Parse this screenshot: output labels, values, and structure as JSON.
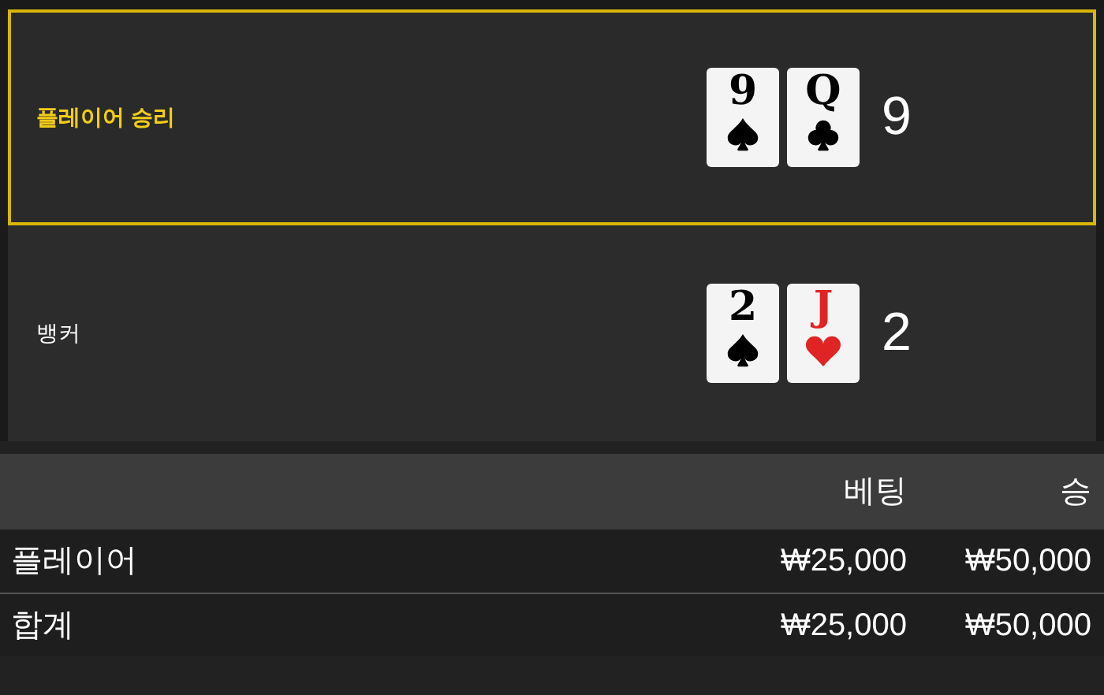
{
  "hands": [
    {
      "label": "플레이어 승리",
      "winner": true,
      "cards": [
        {
          "rank": "9",
          "kind": "spade"
        },
        {
          "rank": "Q",
          "kind": "club"
        }
      ],
      "score": "9"
    },
    {
      "label": "뱅커",
      "winner": false,
      "cards": [
        {
          "rank": "2",
          "kind": "spade"
        },
        {
          "rank": "J",
          "kind": "heart"
        }
      ],
      "score": "2"
    }
  ],
  "bets_table": {
    "columns": [
      "베팅",
      "승"
    ],
    "rows": [
      {
        "label": "플레이어",
        "cells": [
          "₩25,000",
          "₩50,000"
        ]
      },
      {
        "label": "합계",
        "cells": [
          "₩25,000",
          "₩50,000"
        ]
      }
    ]
  }
}
